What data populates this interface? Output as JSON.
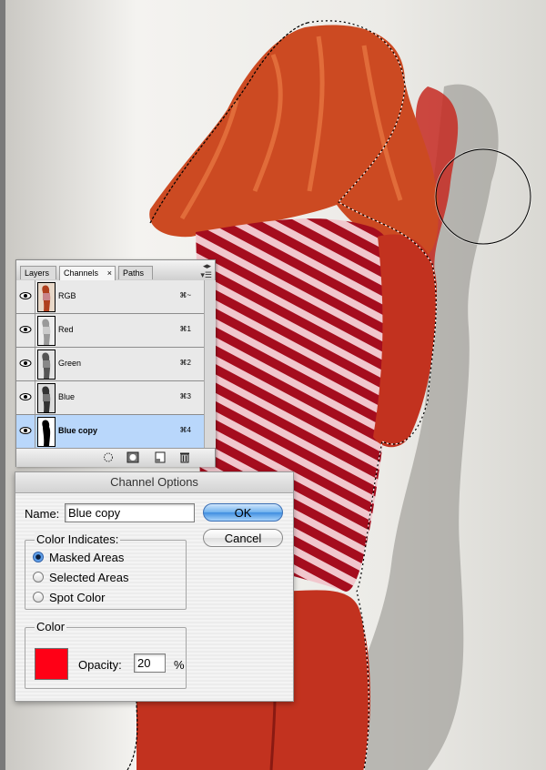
{
  "palette": {
    "tabs": [
      {
        "label": "Layers"
      },
      {
        "label": "Channels"
      },
      {
        "label": "Paths"
      }
    ],
    "tab_close_glyph": "×",
    "channels": [
      {
        "name": "RGB",
        "shortcut": "⌘~",
        "visible": true,
        "selected": false
      },
      {
        "name": "Red",
        "shortcut": "⌘1",
        "visible": true,
        "selected": false
      },
      {
        "name": "Green",
        "shortcut": "⌘2",
        "visible": true,
        "selected": false
      },
      {
        "name": "Blue",
        "shortcut": "⌘3",
        "visible": true,
        "selected": false
      },
      {
        "name": "Blue copy",
        "shortcut": "⌘4",
        "visible": true,
        "selected": true
      }
    ],
    "footer_icons": [
      "load-selection-icon",
      "save-selection-icon",
      "new-channel-icon",
      "trash-icon"
    ]
  },
  "dialog": {
    "title": "Channel Options",
    "name_label": "Name:",
    "name_value": "Blue copy",
    "ok_label": "OK",
    "cancel_label": "Cancel",
    "color_indicates": {
      "legend": "Color Indicates:",
      "options": [
        {
          "label": "Masked Areas",
          "checked": true
        },
        {
          "label": "Selected Areas",
          "checked": false
        },
        {
          "label": "Spot Color",
          "checked": false
        }
      ]
    },
    "color": {
      "legend": "Color",
      "swatch": "#ff0016",
      "opacity_label": "Opacity:",
      "opacity_value": "20",
      "percent": "%"
    }
  },
  "colors": {
    "accent_blue": "#6fb1ee",
    "selected_row": "#b9d7fb",
    "mask_overlay": "#c8281e"
  }
}
